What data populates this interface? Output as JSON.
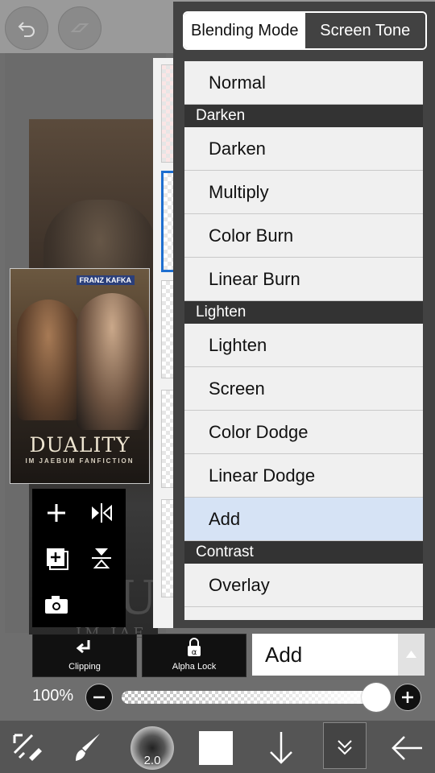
{
  "blend_popup": {
    "tabs": [
      {
        "label": "Blending Mode",
        "active": true
      },
      {
        "label": "Screen Tone",
        "active": false
      }
    ],
    "items": [
      {
        "label": "Normal",
        "type": "item"
      },
      {
        "label": "Darken",
        "type": "header"
      },
      {
        "label": "Darken",
        "type": "item"
      },
      {
        "label": "Multiply",
        "type": "item"
      },
      {
        "label": "Color Burn",
        "type": "item"
      },
      {
        "label": "Linear Burn",
        "type": "item"
      },
      {
        "label": "Lighten",
        "type": "header"
      },
      {
        "label": "Lighten",
        "type": "item"
      },
      {
        "label": "Screen",
        "type": "item"
      },
      {
        "label": "Color Dodge",
        "type": "item"
      },
      {
        "label": "Linear Dodge",
        "type": "item"
      },
      {
        "label": "Add",
        "type": "item",
        "selected": true
      },
      {
        "label": "Contrast",
        "type": "header"
      },
      {
        "label": "Overlay",
        "type": "item"
      }
    ]
  },
  "artwork": {
    "thumbnail_sign": "FRANZ KAFKA",
    "thumbnail_title": "DUALITY",
    "thumbnail_subtitle": "IM JAEBUM FANFICTION",
    "canvas_text": "DU",
    "canvas_subtext": "IM JAE"
  },
  "layer_options": {
    "clipping_label": "Clipping",
    "alpha_lock_label": "Alpha Lock",
    "blend_mode_value": "Add",
    "opacity_label": "100%",
    "opacity_value": 1.0
  },
  "toolbar": {
    "brush_size": "2.0",
    "color": "#ffffff"
  },
  "colors": {
    "selected_item_bg": "#d6e3f5",
    "popup_bg": "#424242",
    "header_bg": "#333333",
    "selection_blue": "#1e6fd0"
  }
}
